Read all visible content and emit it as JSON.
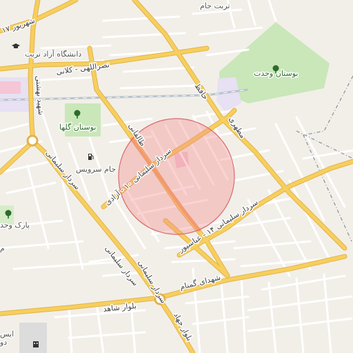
{
  "map": {
    "colors": {
      "background": "#f2efe9",
      "major_road": "#f6cf5d",
      "major_road_casing": "#e3b24a",
      "minor_road": "#ffffff",
      "park": "#c9e7b8",
      "campus": "#e8e0f3",
      "railway": "#b8c3cc",
      "boundary": "#8c8c99",
      "radius_fill": "#f28c8c",
      "radius_stroke": "#d96a6a"
    },
    "labels": {
      "torbat_jam": "تربت جام",
      "shahrivar17": "۱۷ شهریور",
      "azad_university": "دانشگاه آزاد تربت",
      "nasrollahi_kalani": "نصراللهی - کلانی",
      "bostan_vahdat": "بوستان وحدت",
      "hafez": "حافظ",
      "motahari": "مطهری",
      "bostan_golha": "بوستان گلها",
      "jam_service": "جام سرویس",
      "sardar_soleimani_10_azadi": "سردار سلیمانی ۱۰ - آزادی",
      "taleghani": "طالقانی",
      "sardar_soleimani_16_abbaspour": "سردار سلیمانی ۱۴ - عباسپور",
      "sardar_soleimani_w": "سردار سلیمانی",
      "sardar_soleimani_sw": "سردار سلیمانی",
      "sardar_soleimani_s": "سردار سلیمانی",
      "park_vahdat_w": "پارک وحد",
      "shohada_gomnam": "شهدای گمنام",
      "bolvar_shahed": "بلوار شاهد",
      "bolvar_jahad": "بلوار جهاد",
      "shahid_beheshti": "شهید بهشتی",
      "edge_do": "دو",
      "edge_ma": "م",
      "edge_isa": "ایس"
    },
    "icons": {
      "park_icon": "tree-icon",
      "university_icon": "graduation-cap-icon",
      "fuel_icon": "fuel-station-icon",
      "building_icon": "building-icon"
    }
  }
}
